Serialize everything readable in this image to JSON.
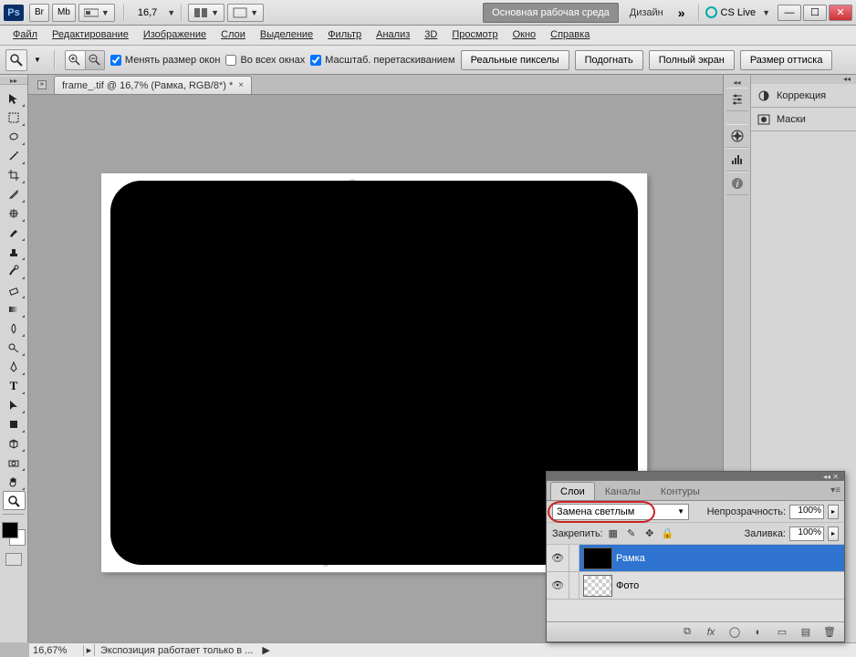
{
  "titlebar": {
    "zoom": "16,7",
    "workspace": "Основная рабочая среда",
    "design": "Дизайн",
    "cslive": "CS Live"
  },
  "menu": [
    "Файл",
    "Редактирование",
    "Изображение",
    "Слои",
    "Выделение",
    "Фильтр",
    "Анализ",
    "3D",
    "Просмотр",
    "Окно",
    "Справка"
  ],
  "options": {
    "resize_windows": "Менять размер окон",
    "all_windows": "Во всех окнах",
    "scrubby_zoom": "Масштаб. перетаскиванием",
    "btn_actual": "Реальные пикселы",
    "btn_fit": "Подогнать",
    "btn_full": "Полный экран",
    "btn_print": "Размер оттиска",
    "resize_checked": true,
    "all_checked": false,
    "scrubby_checked": true
  },
  "doc_tab": "frame_.tif @ 16,7% (Рамка, RGB/8*) *",
  "right_panels": {
    "correction": "Коррекция",
    "masks": "Маски"
  },
  "layers": {
    "tabs": {
      "layers": "Слои",
      "channels": "Каналы",
      "paths": "Контуры"
    },
    "blend_mode": "Замена светлым",
    "opacity_label": "Непрозрачность:",
    "opacity_value": "100%",
    "lock_label": "Закрепить:",
    "fill_label": "Заливка:",
    "fill_value": "100%",
    "rows": [
      {
        "name": "Рамка",
        "thumb": "black",
        "selected": true
      },
      {
        "name": "Фото",
        "thumb": "check",
        "selected": false
      }
    ]
  },
  "status": {
    "zoom": "16,67%",
    "message": "Экспозиция работает только в ..."
  }
}
